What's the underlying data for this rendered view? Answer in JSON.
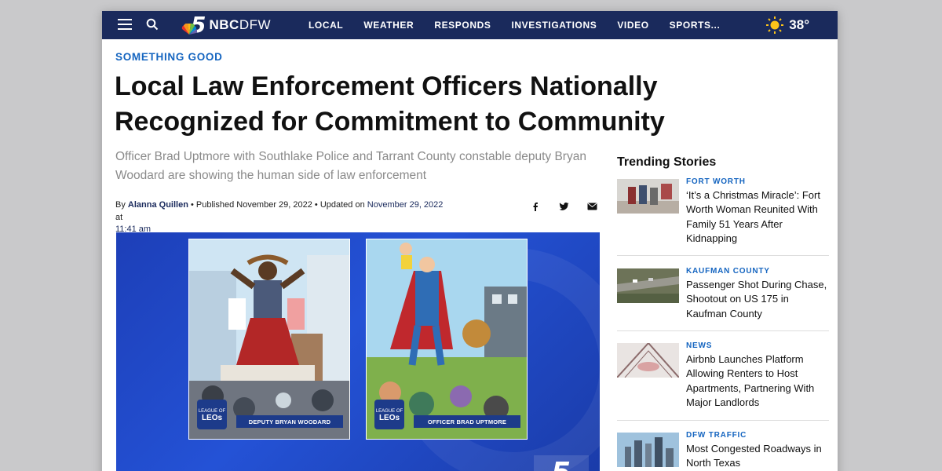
{
  "nav": {
    "logo_number": "5",
    "brand_bold": "NBC",
    "brand_light": "DFW",
    "links": [
      "LOCAL",
      "WEATHER",
      "RESPONDS",
      "INVESTIGATIONS",
      "VIDEO",
      "SPORTS..."
    ],
    "temperature": "38°"
  },
  "article": {
    "kicker": "SOMETHING GOOD",
    "headline": "Local Law Enforcement Officers Nationally Recognized for Commitment to Community",
    "dek": "Officer Brad Uptmore with Southlake Police and Tarrant County constable deputy Bryan Woodard are showing the human side of law enforcement",
    "byline": {
      "by": "By",
      "author": "Alanna Quillen",
      "published": " • Published November 29, 2022 • Updated on ",
      "updated_date": "November 29, 2022",
      "at": " at",
      "updated_time": "11:41 am"
    },
    "share": [
      "facebook-icon",
      "twitter-icon",
      "email-icon"
    ]
  },
  "hero": {
    "card_left_label": "DEPUTY BRYAN WOODARD",
    "card_right_label": "OFFICER BRAD UPTMORE",
    "leo_top": "LEAGUE OF",
    "leo_main": "LEOs"
  },
  "sidebar": {
    "heading": "Trending Stories",
    "stories": [
      {
        "category": "FORT WORTH",
        "title": "‘It’s a Christmas Miracle’: Fort Worth Woman Reunited With Family 51 Years After Kidnapping"
      },
      {
        "category": "KAUFMAN COUNTY",
        "title": "Passenger Shot During Chase, Shootout on US 175 in Kaufman County"
      },
      {
        "category": "NEWS",
        "title": "Airbnb Launches Platform Allowing Renters to Host Apartments, Partnering With Major Landlords"
      },
      {
        "category": "DFW TRAFFIC",
        "title": "Most Congested Roadways in North Texas"
      }
    ]
  },
  "colors": {
    "nav": "#1a2a5c",
    "accent": "#1565c0"
  }
}
